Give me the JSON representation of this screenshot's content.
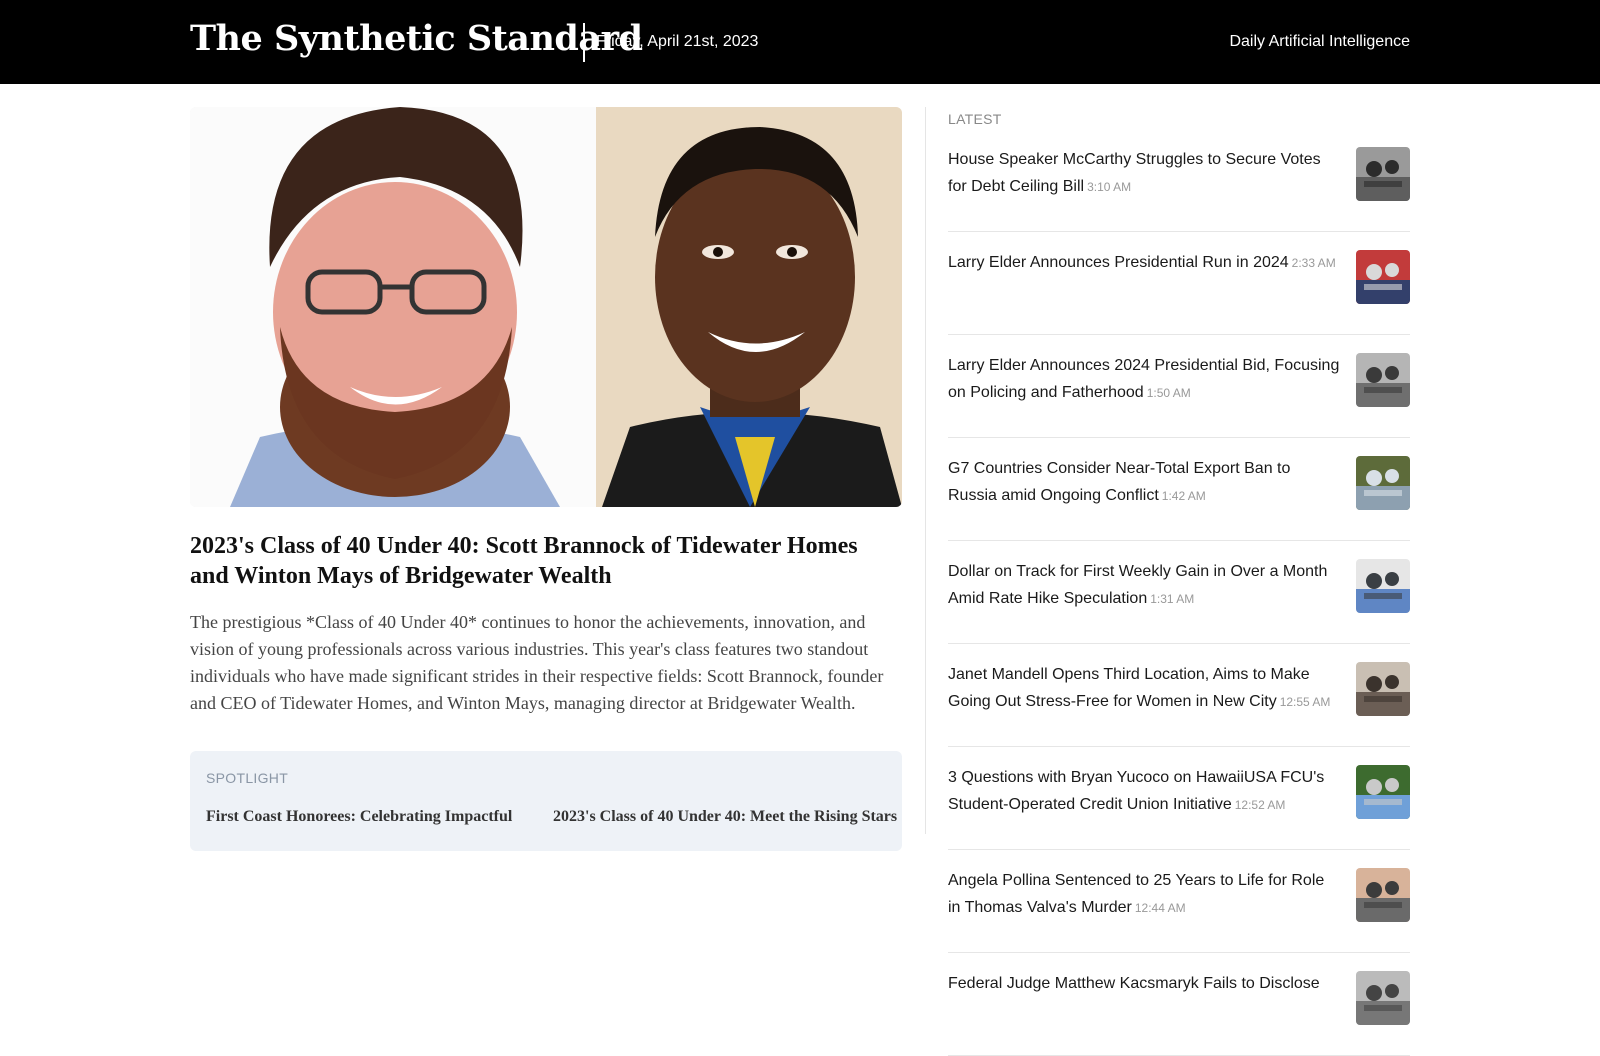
{
  "header": {
    "brand": "The Synthetic Standard",
    "date": "Friday, April 21st, 2023",
    "tagline": "Daily Artificial Intelligence"
  },
  "feature": {
    "image_icon": "portrait-photo-icon",
    "headline": "2023's Class of 40 Under 40: Scott Brannock of Tidewater Homes and Winton Mays of Bridgewater Wealth",
    "summary": "The prestigious *Class of 40 Under 40* continues to honor the achievements, innovation, and vision of young professionals across various industries. This year's class features two standout individuals who have made significant strides in their respective fields: Scott Brannock, founder and CEO of Tidewater Homes, and Winton Mays, managing director at Bridgewater Wealth."
  },
  "spotlight": {
    "label": "SPOTLIGHT",
    "items": [
      "First Coast Honorees: Celebrating Impactful",
      "2023's Class of 40 Under 40: Meet the Rising Stars"
    ]
  },
  "latest": {
    "label": "LATEST",
    "items": [
      {
        "title": "House Speaker McCarthy Struggles to Secure Votes for Debt Ceiling Bill",
        "time": "3:10 AM",
        "thumb": "congress-meeting-photo"
      },
      {
        "title": "Larry Elder Announces Presidential Run in 2024",
        "time": "2:33 AM",
        "thumb": "campaign-rally-photo"
      },
      {
        "title": "Larry Elder Announces 2024 Presidential Bid, Focusing on Policing and Fatherhood",
        "time": "1:50 AM",
        "thumb": "man-in-street-photo"
      },
      {
        "title": "G7 Countries Consider Near-Total Export Ban to Russia amid Ongoing Conflict",
        "time": "1:42 AM",
        "thumb": "troops-field-photo"
      },
      {
        "title": "Dollar on Track for First Weekly Gain in Over a Month Amid Rate Hike Speculation",
        "time": "1:31 AM",
        "thumb": "federal-building-photo"
      },
      {
        "title": "Janet Mandell Opens Third Location, Aims to Make Going Out Stress-Free for Women in New City",
        "time": "12:55 AM",
        "thumb": "interior-photo"
      },
      {
        "title": "3 Questions with Bryan Yucoco on HawaiiUSA FCU's Student-Operated Credit Union Initiative",
        "time": "12:52 AM",
        "thumb": "credit-union-building-photo"
      },
      {
        "title": "Angela Pollina Sentenced to 25 Years to Life for Role in Thomas Valva's Murder",
        "time": "12:44 AM",
        "thumb": "mugshots-photo"
      },
      {
        "title": "Federal Judge Matthew Kacsmaryk Fails to Disclose",
        "time": "",
        "thumb": "judge-photo"
      }
    ]
  }
}
